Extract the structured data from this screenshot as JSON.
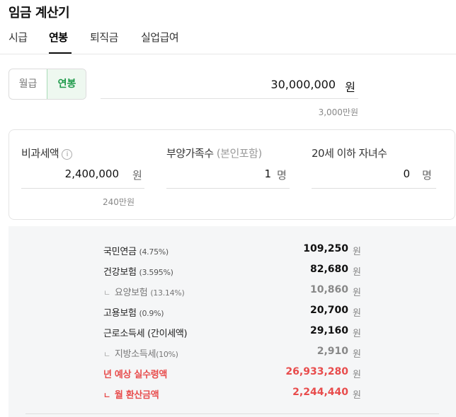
{
  "app": {
    "title": "임금 계산기"
  },
  "tabs": [
    {
      "label": "시급"
    },
    {
      "label": "연봉"
    },
    {
      "label": "퇴직금"
    },
    {
      "label": "실업급여"
    }
  ],
  "pay_toggle": {
    "monthly": "월급",
    "yearly": "연봉",
    "selected": "연봉"
  },
  "salary": {
    "value": "30,000,000",
    "unit": "원",
    "hint": "3,000만원"
  },
  "settings": {
    "nontax": {
      "label": "비과세액",
      "value": "2,400,000",
      "unit": "원",
      "hint": "240만원",
      "icon": "info-icon"
    },
    "dependents": {
      "label": "부양가족수",
      "label_sub": "(본인포함)",
      "value": "1",
      "unit": "명"
    },
    "children": {
      "label": "20세 이하 자녀수",
      "value": "0",
      "unit": "명"
    }
  },
  "results": [
    {
      "label": "국민연금",
      "rate": "(4.75%)",
      "value": "109,250",
      "unit": "원"
    },
    {
      "label": "건강보험",
      "rate": "(3.595%)",
      "value": "82,680",
      "unit": "원"
    },
    {
      "branch": "ㄴ",
      "label": "요양보험",
      "rate": "(13.14%)",
      "value": "10,860",
      "unit": "원"
    },
    {
      "label": "고용보험",
      "rate": "(0.9%)",
      "value": "20,700",
      "unit": "원"
    },
    {
      "label": "근로소득세 (간이세액)",
      "value": "29,160",
      "unit": "원"
    },
    {
      "branch": "ㄴ",
      "label": "지방소득세",
      "rate": "(10%)",
      "value": "2,910",
      "unit": "원"
    },
    {
      "label": "년 예상 실수령액",
      "value": "26,933,280",
      "unit": "원"
    },
    {
      "branch": "ㄴ",
      "label": "월 환산금액",
      "value": "2,244,440",
      "unit": "원"
    }
  ],
  "colors": {
    "accent_green": "#1e9a4a",
    "accent_red": "#e84c4c"
  }
}
